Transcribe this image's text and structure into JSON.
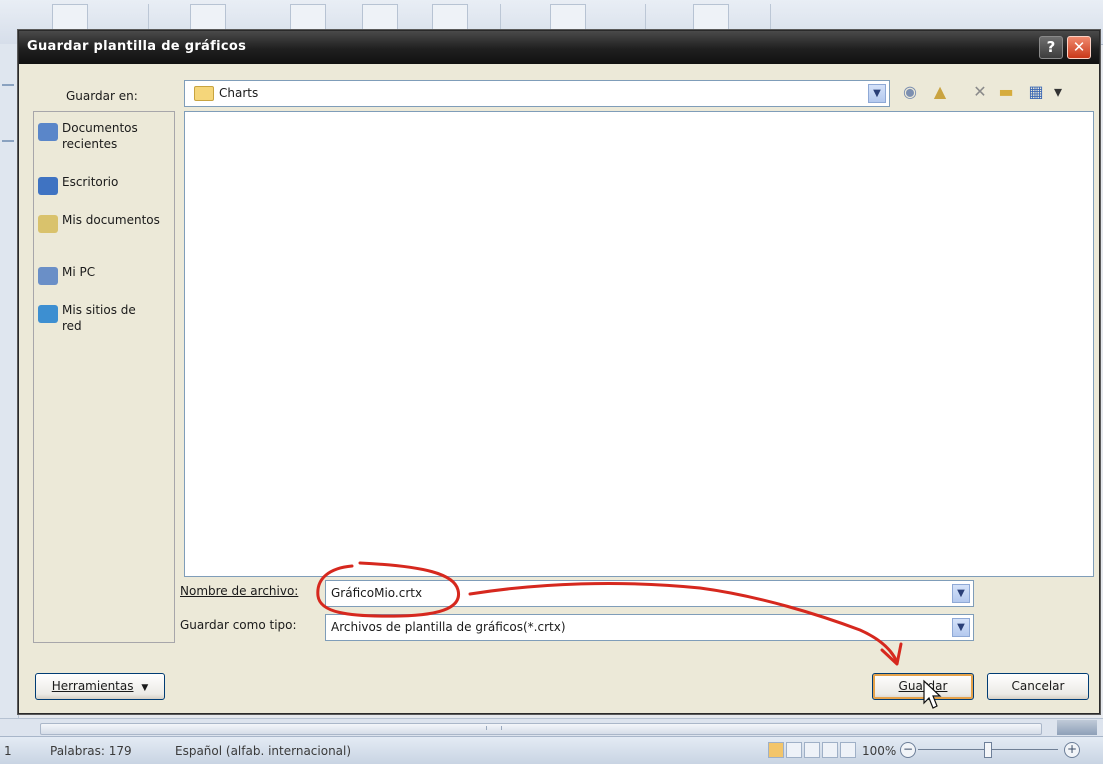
{
  "statusbar": {
    "page": "1",
    "words": "Palabras: 179",
    "language": "Español (alfab. internacional)",
    "zoom": "100%",
    "zoom_minus": "−",
    "zoom_plus": "+"
  },
  "dialog": {
    "title": "Guardar plantilla de gráficos",
    "help_glyph": "?",
    "close_glyph": "✕",
    "save_in_label": "Guardar en:",
    "current_folder": "Charts",
    "places": [
      {
        "label": "Documentos recientes",
        "icon": "recent-documents-icon",
        "color": "#5a86c9"
      },
      {
        "label": "Escritorio",
        "icon": "desktop-icon",
        "color": "#3f73c2"
      },
      {
        "label": "Mis documentos",
        "icon": "my-documents-icon",
        "color": "#d9c26c"
      },
      {
        "label": "Mi PC",
        "icon": "my-computer-icon",
        "color": "#6a8fc7"
      },
      {
        "label": "Mis sitios de red",
        "icon": "network-places-icon",
        "color": "#3d8fd1"
      }
    ],
    "filename_label": "Nombre de archivo:",
    "filename_value": "GráficoMio.crtx",
    "filetype_label": "Guardar como tipo:",
    "filetype_value": "Archivos de plantilla de gráficos(*.crtx)",
    "tools_label": "Herramientas",
    "save_label": "Guardar",
    "cancel_label": "Cancelar",
    "annotation_color": "#d6281e"
  }
}
